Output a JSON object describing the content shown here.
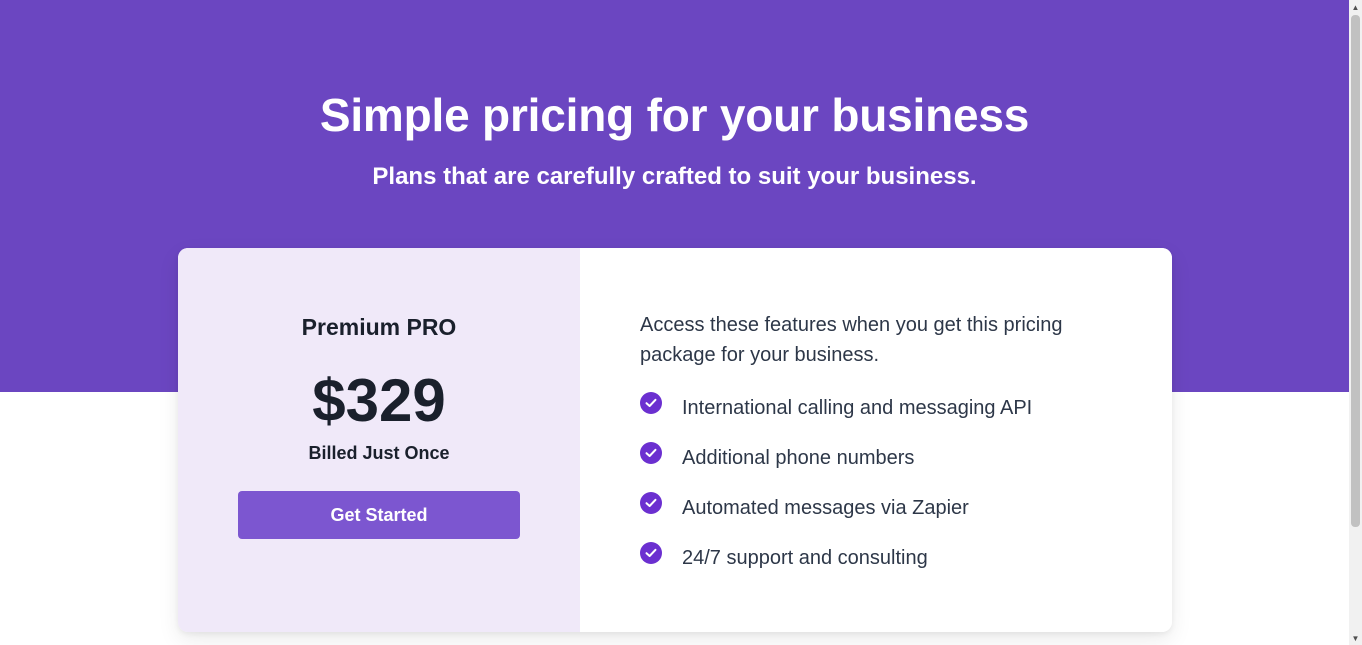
{
  "hero": {
    "title": "Simple pricing for your business",
    "subtitle": "Plans that are carefully crafted to suit your business."
  },
  "plan": {
    "name": "Premium PRO",
    "price": "$329",
    "billing": "Billed Just Once",
    "cta_label": "Get Started"
  },
  "features_panel": {
    "intro": "Access these features when you get this pricing package for your business.",
    "items": [
      {
        "label": "International calling and messaging API",
        "icon": "check-circle-icon"
      },
      {
        "label": "Additional phone numbers",
        "icon": "check-circle-icon"
      },
      {
        "label": "Automated messages via Zapier",
        "icon": "check-circle-icon"
      },
      {
        "label": "24/7 support and consulting",
        "icon": "check-circle-icon"
      }
    ]
  },
  "scrollbar": {
    "up_glyph": "▲",
    "down_glyph": "▼"
  },
  "colors": {
    "hero_background": "#6b46c1",
    "plan_panel_background": "#f0e9f9",
    "cta_background": "#7c56d0",
    "check_icon": "#6b2fd0"
  }
}
